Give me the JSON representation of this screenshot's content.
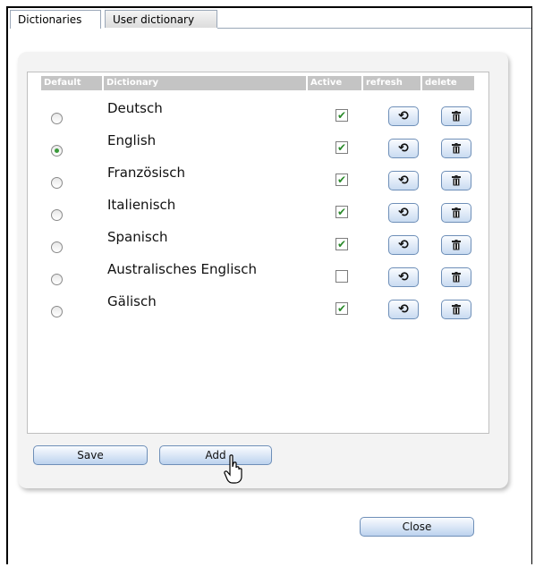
{
  "tabs": [
    {
      "label": "Dictionaries",
      "active": true
    },
    {
      "label": "User dictionary",
      "active": false
    }
  ],
  "table": {
    "headers": {
      "default": "Default",
      "dictionary": "Dictionary",
      "active": "Active",
      "refresh": "refresh",
      "delete": "delete"
    },
    "rows": [
      {
        "name": "Deutsch",
        "default": false,
        "active": true
      },
      {
        "name": "English",
        "default": true,
        "active": true
      },
      {
        "name": "Französisch",
        "default": false,
        "active": true
      },
      {
        "name": "Italienisch",
        "default": false,
        "active": true
      },
      {
        "name": "Spanisch",
        "default": false,
        "active": true
      },
      {
        "name": "Australisches Englisch",
        "default": false,
        "active": false
      },
      {
        "name": "Gälisch",
        "default": false,
        "active": true
      }
    ]
  },
  "buttons": {
    "save": "Save",
    "add": "Add",
    "close": "Close"
  },
  "icons": {
    "refresh": "refresh-icon",
    "delete": "trash-icon",
    "cursor": "hand-pointer-icon"
  },
  "colors": {
    "check": "#2b8a2b",
    "radio_on": "#3a9a3a",
    "header_bg": "#c4c4c4",
    "button_border": "#6e8fb8"
  }
}
